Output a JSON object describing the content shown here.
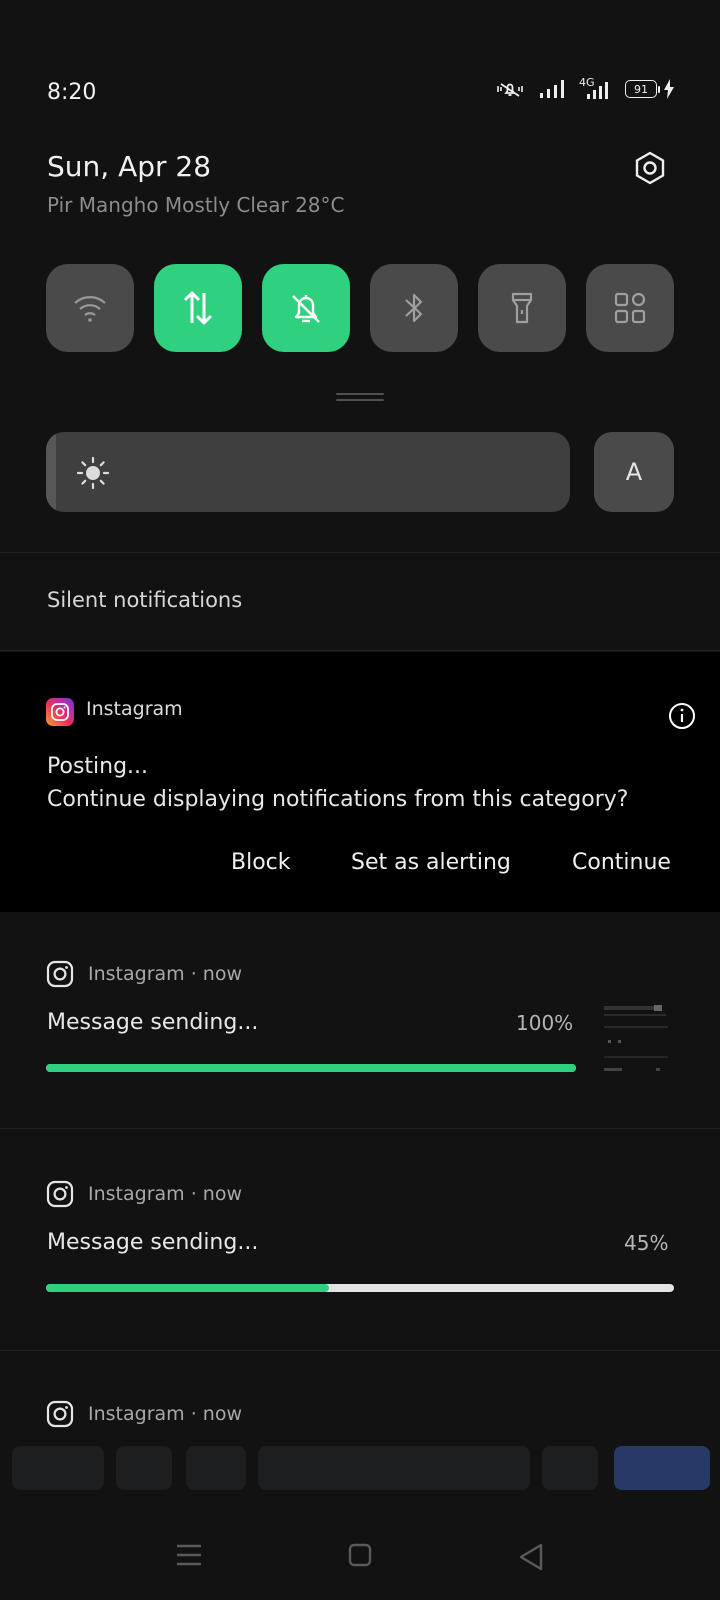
{
  "status_bar": {
    "time": "8:20",
    "network_type": "4G",
    "battery_level": "91"
  },
  "header": {
    "date": "Sun, Apr 28",
    "weather": "Pir Mangho Mostly Clear 28°C"
  },
  "quick_tiles": [
    {
      "name": "wifi-icon",
      "on": false
    },
    {
      "name": "mobile-data-icon",
      "on": true
    },
    {
      "name": "silent-mode-icon",
      "on": true
    },
    {
      "name": "bluetooth-icon",
      "on": false
    },
    {
      "name": "flashlight-icon",
      "on": false
    },
    {
      "name": "more-tiles-icon",
      "on": false
    }
  ],
  "brightness": {
    "level": 0.02,
    "auto_label": "A"
  },
  "silent_section": {
    "header": "Silent notifications"
  },
  "category_prompt": {
    "app_name": "Instagram",
    "title": "Posting...",
    "question": "Continue displaying notifications from this category?",
    "actions": {
      "block": "Block",
      "set_alerting": "Set as alerting",
      "continue": "Continue"
    }
  },
  "notifications": [
    {
      "app_name": "Instagram · now",
      "message": "Message sending...",
      "percent_label": "100%",
      "progress": 1.0
    },
    {
      "app_name": "Instagram · now",
      "message": "Message sending...",
      "percent_label": "45%",
      "progress": 0.45
    },
    {
      "app_name": "Instagram · now"
    }
  ],
  "colors": {
    "accent": "#2fd17e",
    "tile_off": "#4a4a4b",
    "background": "#121213",
    "prompt_background": "#000000"
  }
}
